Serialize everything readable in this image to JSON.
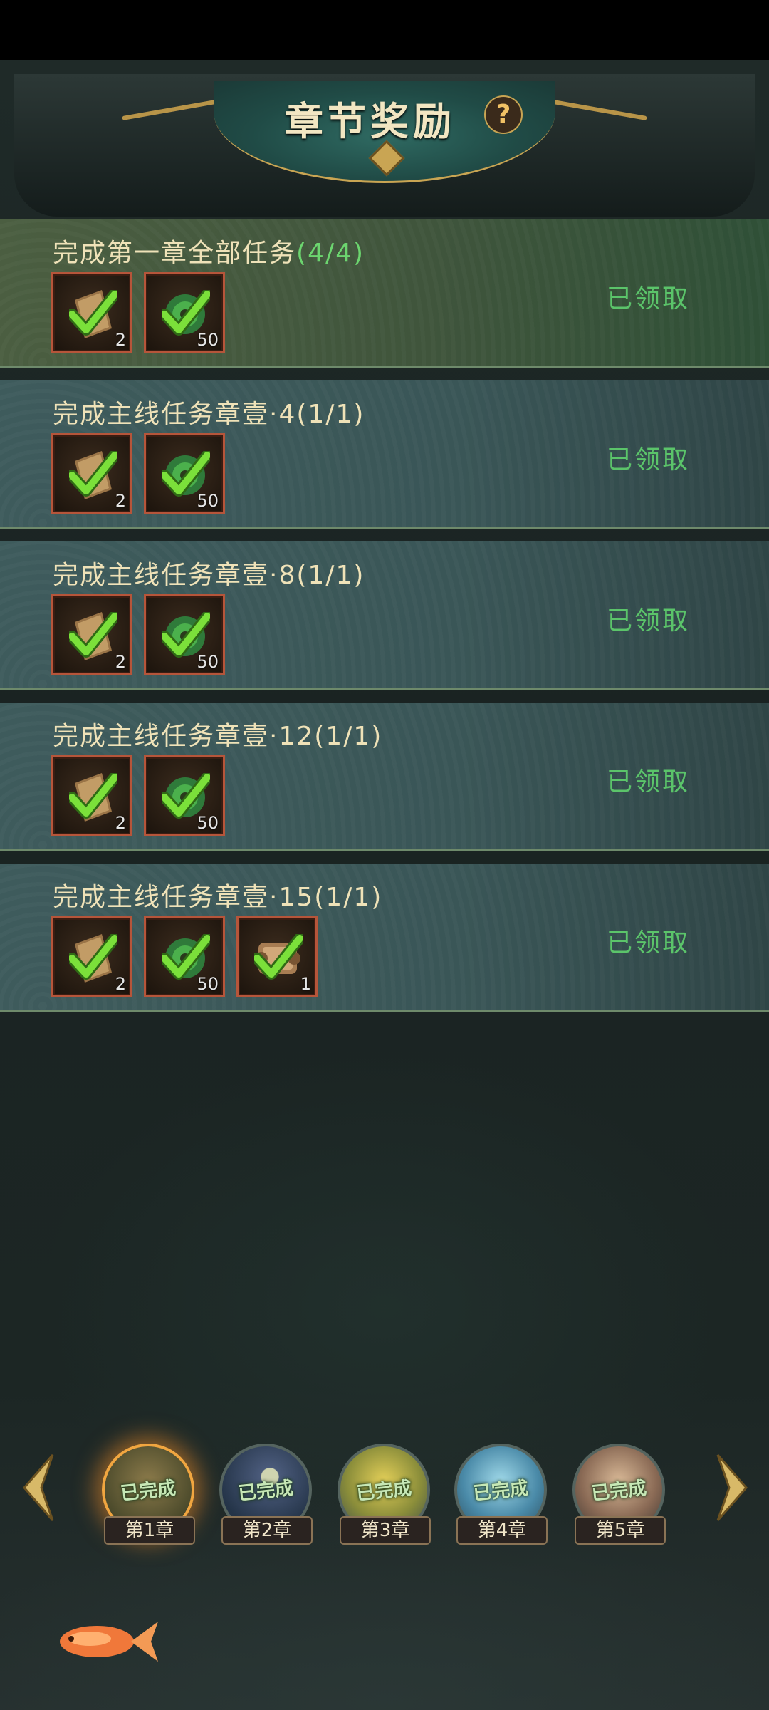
{
  "header": {
    "title": "章节奖励",
    "help_label": "?"
  },
  "rows": [
    {
      "title": "完成第一章全部任务",
      "progress": "(4/4)",
      "status": "已领取",
      "items": [
        {
          "icon": "scroll-icon",
          "count": "2"
        },
        {
          "icon": "jade-coin-icon",
          "count": "50"
        }
      ]
    },
    {
      "title": "完成主线任务章壹·4",
      "progress": "(1/1)",
      "status": "已领取",
      "items": [
        {
          "icon": "scroll-icon",
          "count": "2"
        },
        {
          "icon": "jade-coin-icon",
          "count": "50"
        }
      ]
    },
    {
      "title": "完成主线任务章壹·8",
      "progress": "(1/1)",
      "status": "已领取",
      "items": [
        {
          "icon": "scroll-icon",
          "count": "2"
        },
        {
          "icon": "jade-coin-icon",
          "count": "50"
        }
      ]
    },
    {
      "title": "完成主线任务章壹·12",
      "progress": "(1/1)",
      "status": "已领取",
      "items": [
        {
          "icon": "scroll-icon",
          "count": "2"
        },
        {
          "icon": "jade-coin-icon",
          "count": "50"
        }
      ]
    },
    {
      "title": "完成主线任务章壹·15",
      "progress": "(1/1)",
      "status": "已领取",
      "items": [
        {
          "icon": "scroll-icon",
          "count": "2"
        },
        {
          "icon": "jade-coin-icon",
          "count": "50"
        },
        {
          "icon": "rolled-scroll-icon",
          "count": "1"
        }
      ]
    }
  ],
  "chapters": [
    {
      "label": "第1章",
      "stamp": "已完成",
      "active": true
    },
    {
      "label": "第2章",
      "stamp": "已完成",
      "active": false
    },
    {
      "label": "第3章",
      "stamp": "已完成",
      "active": false
    },
    {
      "label": "第4章",
      "stamp": "已完成",
      "active": false
    },
    {
      "label": "第5章",
      "stamp": "已完成",
      "active": false
    }
  ],
  "colors": {
    "gold": "#c9a553",
    "claimed_green": "#5bc46a",
    "progress_green": "#6cd56f",
    "active_glow": "#f1a640"
  }
}
